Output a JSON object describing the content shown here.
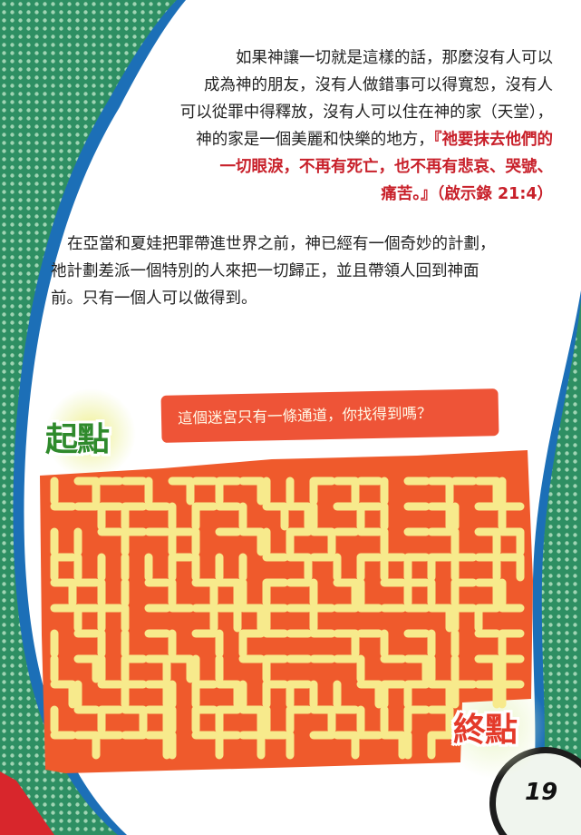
{
  "page": {
    "paragraph1": {
      "lines": [
        "如果神讓一切就是這樣的話，那麼沒有人可以",
        "成為神的朋友，沒有人做錯事可以得寬恕，沒有人",
        "可以從罪中得釋放，沒有人可以住在神的家（天堂），"
      ],
      "line4_plain": "神的家是一個美麗和快樂的地方，",
      "line4_red": "『祂要抹去他們的",
      "line5_red": "一切眼淚，不再有死亡，也不再有悲哀、哭號、",
      "line6_red": "痛苦。』（啟示錄 21:4）"
    },
    "paragraph2": {
      "lines": [
        "在亞當和夏娃把罪帶進世界之前，神已經有一個奇妙的計劃，",
        "祂計劃差派一個特別的人來把一切歸正，並且帶領人回到神面",
        "前。只有一個人可以做得到。"
      ]
    },
    "maze": {
      "start_label": "起點",
      "end_label": "終點",
      "prompt": "這個迷宮只有一條通道，你找得到嗎？"
    },
    "page_number": "19",
    "colors": {
      "background_green": "#2e8f63",
      "page_white": "#ffffff",
      "border_blue": "#1c6fb7",
      "highlight_red": "#c8202a",
      "maze_orange": "#ef5a2c",
      "maze_path_yellow": "#f7ea8c",
      "start_green": "#2f8a2c",
      "end_red": "#e43a2a"
    }
  }
}
